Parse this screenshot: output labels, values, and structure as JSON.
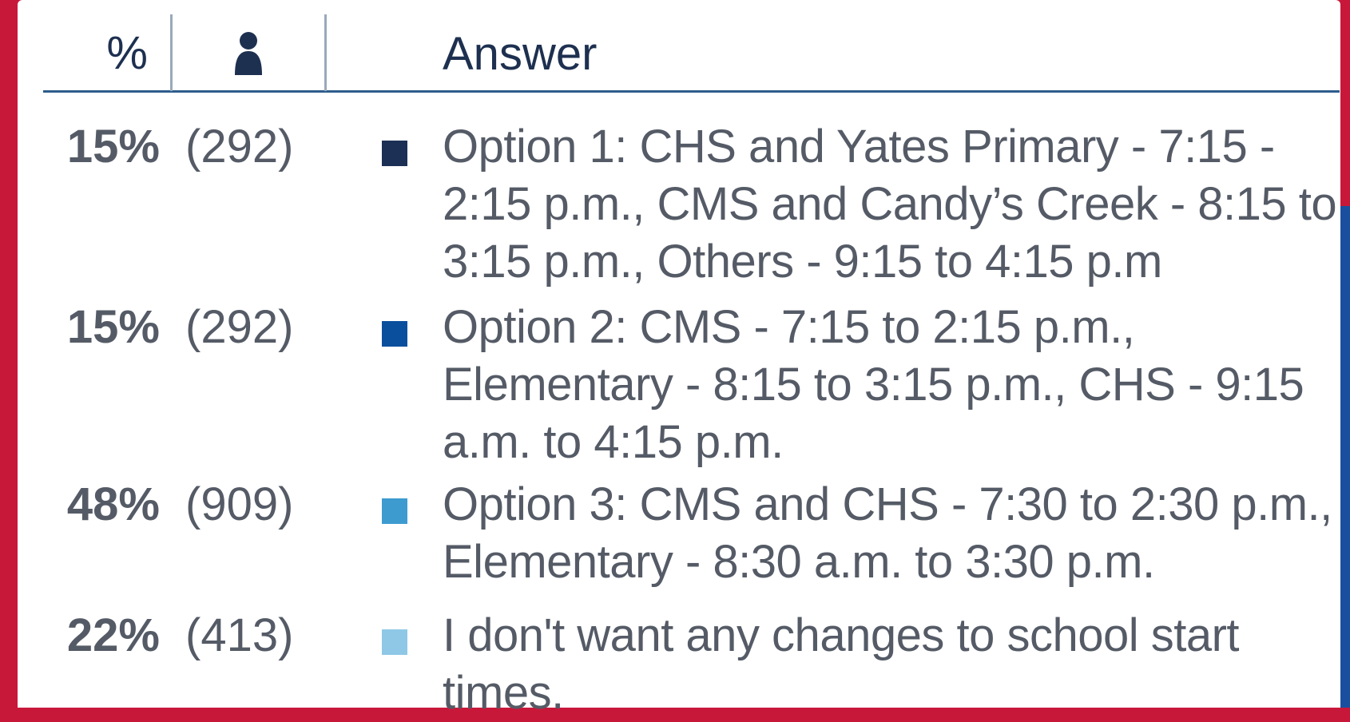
{
  "header": {
    "percent_label": "%",
    "person_icon": "person-icon",
    "answer_label": "Answer"
  },
  "rows": [
    {
      "percent": "15%",
      "count": "(292)",
      "color": "#1c2f55",
      "answer": "Option 1: CHS and Yates Primary - 7:15 - 2:15 p.m., CMS and Candy’s Creek - 8:15 to 3:15 p.m., Others - 9:15 to 4:15 p.m"
    },
    {
      "percent": "15%",
      "count": "(292)",
      "color": "#0a4f9e",
      "answer": "Option 2: CMS - 7:15 to 2:15 p.m., Elementary - 8:15 to 3:15 p.m., CHS - 9:15 a.m. to 4:15 p.m."
    },
    {
      "percent": "48%",
      "count": "(909)",
      "color": "#3d9bd0",
      "answer": "Option 3: CMS and CHS - 7:30 to 2:30 p.m., Elementary - 8:30 a.m. to 3:30 p.m."
    },
    {
      "percent": "22%",
      "count": "(413)",
      "color": "#8fc8e6",
      "answer": "I don't want any changes to school start times."
    }
  ]
}
